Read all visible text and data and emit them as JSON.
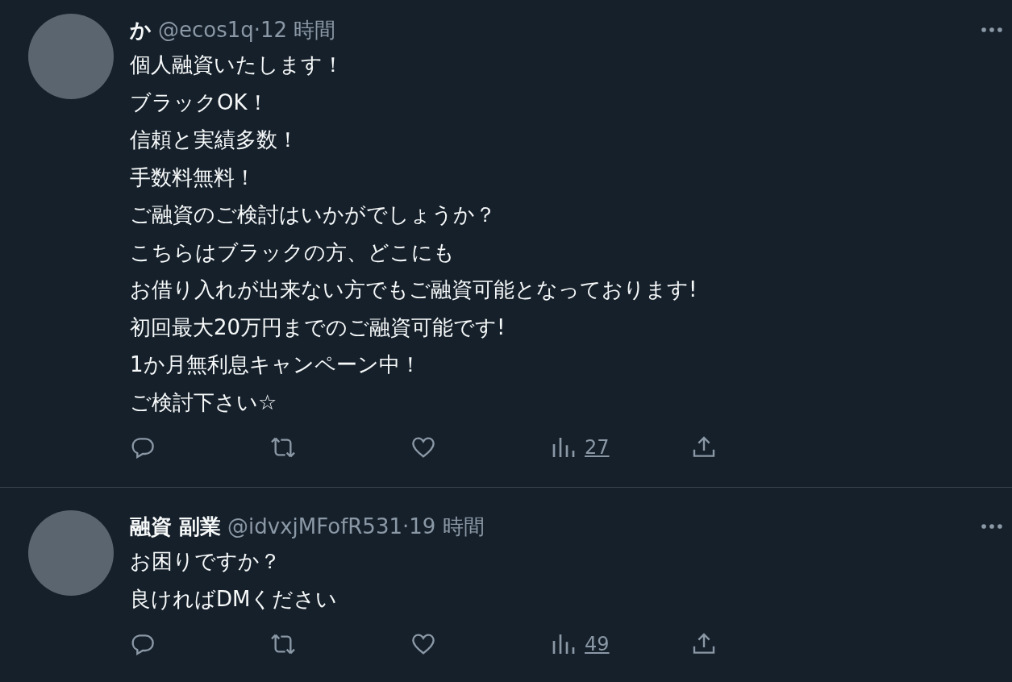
{
  "tweets": [
    {
      "display_name": "か",
      "handle": "@ecos1q",
      "separator": "·",
      "time": "12 時間",
      "lines": [
        "個人融資いたします！",
        "ブラックOK！",
        "信頼と実績多数！",
        "手数料無料！",
        "ご融資のご検討はいかがでしょうか？",
        "こちらはブラックの方、どこにも",
        "お借り入れが出来ない方でもご融資可能となっております!",
        "初回最大20万円までのご融資可能です!",
        "1か月無利息キャンペーン中！",
        "ご検討下さい☆"
      ],
      "views": "27"
    },
    {
      "display_name": "融資 副業",
      "handle": "@idvxjMFofR531",
      "separator": "·",
      "time": "19 時間",
      "lines": [
        "お困りですか？",
        "良ければDMください"
      ],
      "views": "49"
    }
  ]
}
